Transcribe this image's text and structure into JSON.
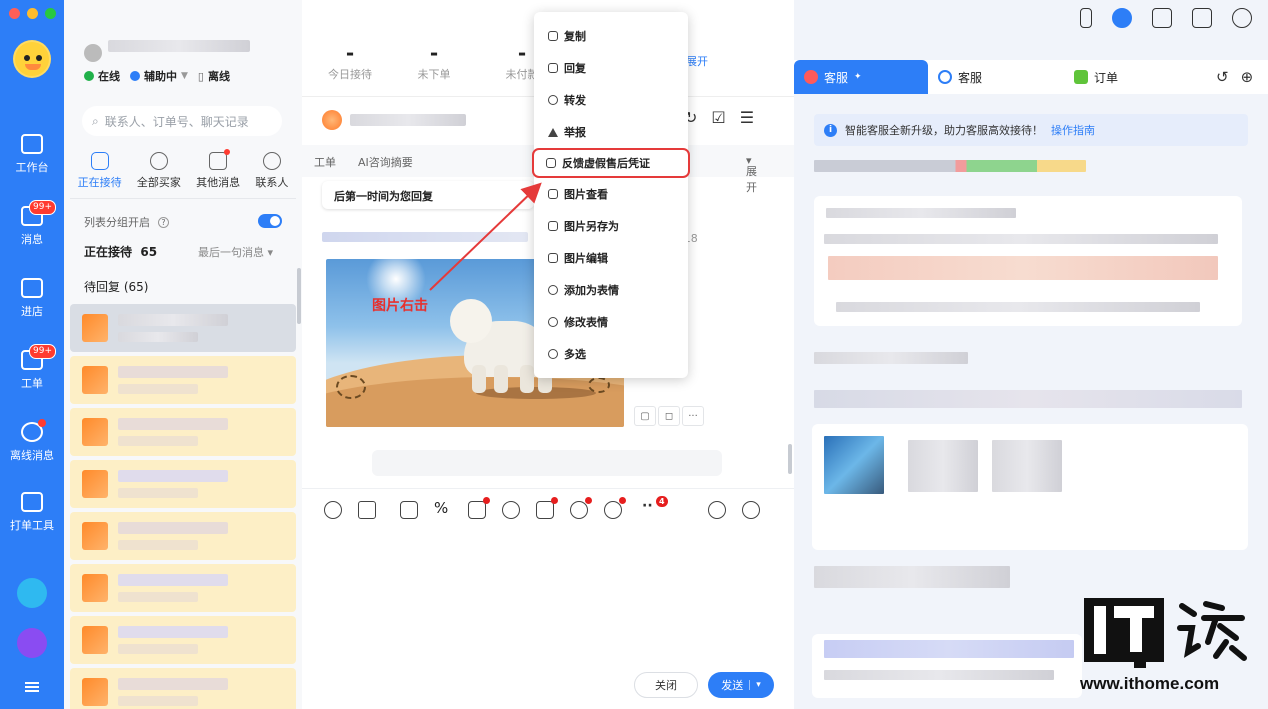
{
  "rail": {
    "items": [
      {
        "label": "工作台",
        "icon": "workbench-icon"
      },
      {
        "label": "消息",
        "icon": "message-icon",
        "badge": "99+"
      },
      {
        "label": "进店",
        "icon": "store-icon"
      },
      {
        "label": "工单",
        "icon": "ticket-icon",
        "badge": "99+"
      },
      {
        "label": "离线消息",
        "icon": "offline-message-icon"
      },
      {
        "label": "打单工具",
        "icon": "print-order-icon"
      }
    ]
  },
  "status": {
    "online": "在线",
    "assist": "辅助中",
    "offline": "离线"
  },
  "search": {
    "placeholder": "联系人、订单号、聊天记录"
  },
  "list_tabs": [
    {
      "label": "正在接待"
    },
    {
      "label": "全部买家"
    },
    {
      "label": "其他消息"
    },
    {
      "label": "联系人"
    }
  ],
  "list": {
    "group_toggle_label": "列表分组开启",
    "serving_label": "正在接待",
    "serving_count": "65",
    "sort_label": "最后一句消息",
    "pending_label": "待回复 (65)"
  },
  "stats": [
    {
      "value": "-",
      "label": "今日接待"
    },
    {
      "value": "-",
      "label": "未下单"
    },
    {
      "value": "-",
      "label": "未付款"
    }
  ],
  "stats_expand": "展开",
  "chat": {
    "subtabs": {
      "ticket": "工单",
      "ai_summary": "AI咨询摘要",
      "expand": "展开"
    },
    "bubble_text": "后第一时间为您回复",
    "time_fragment": ":18",
    "image_annotation": "图片右击",
    "close_button": "关闭",
    "send_button": "发送"
  },
  "toolbar": {
    "more_count": "4"
  },
  "context_menu": [
    {
      "label": "复制",
      "icon": "copy-icon"
    },
    {
      "label": "回复",
      "icon": "reply-icon"
    },
    {
      "label": "转发",
      "icon": "forward-icon"
    },
    {
      "label": "举报",
      "icon": "report-icon"
    },
    {
      "label": "反馈虚假售后凭证",
      "icon": "feedback-icon",
      "highlighted": true
    },
    {
      "label": "图片查看",
      "icon": "image-view-icon"
    },
    {
      "label": "图片另存为",
      "icon": "image-save-icon"
    },
    {
      "label": "图片编辑",
      "icon": "image-edit-icon"
    },
    {
      "label": "添加为表情",
      "icon": "add-sticker-icon"
    },
    {
      "label": "修改表情",
      "icon": "edit-sticker-icon"
    },
    {
      "label": "多选",
      "icon": "multi-select-icon"
    }
  ],
  "right_tabs": [
    {
      "label": "客服",
      "active": true
    },
    {
      "label": "客服",
      "active": false
    },
    {
      "label": "订单",
      "active": false
    }
  ],
  "notice": {
    "text": "智能客服全新升级，助力客服高效接待！",
    "link": "操作指南"
  },
  "watermark": {
    "url": "www.ithome.com"
  },
  "colors": {
    "accent": "#2d7ef7",
    "highlight": "#e53a3a",
    "pending_row": "#fdefc6"
  }
}
